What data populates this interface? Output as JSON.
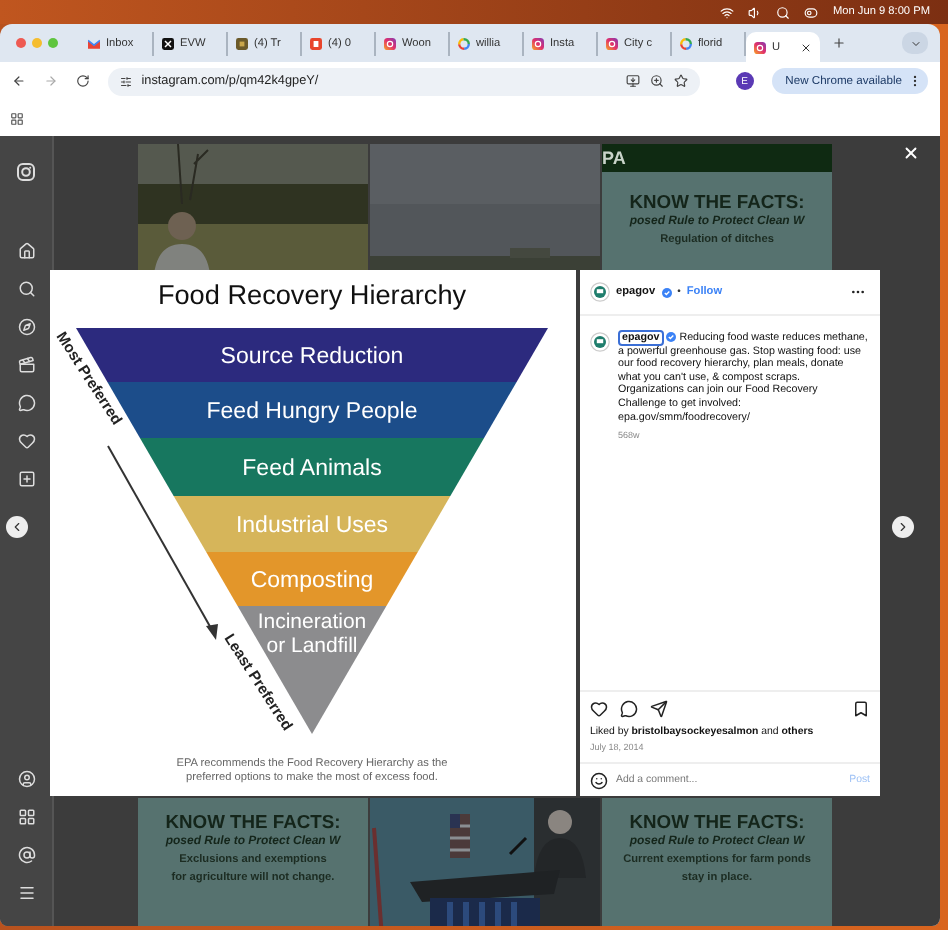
{
  "menu_bar": {
    "clock": "Mon Jun 9 8:00 PM"
  },
  "browser": {
    "tabs": [
      {
        "kind": "gmail",
        "title": "Inbox",
        "selected": false
      },
      {
        "kind": "x",
        "title": "EVW",
        "selected": false
      },
      {
        "kind": "olive",
        "title": "(4) Tr",
        "selected": false
      },
      {
        "kind": "red",
        "title": "(4) 0",
        "selected": false
      },
      {
        "kind": "instagram",
        "title": "Woon",
        "selected": false
      },
      {
        "kind": "google",
        "title": "willia",
        "selected": false
      },
      {
        "kind": "instagram",
        "title": "Insta",
        "selected": false
      },
      {
        "kind": "instagram",
        "title": "City c",
        "selected": false
      },
      {
        "kind": "google",
        "title": "florid",
        "selected": false
      },
      {
        "kind": "instagram",
        "title": "U",
        "selected": true
      }
    ],
    "address": "instagram.com/p/qm42k4gpeY/",
    "profile_initial": "E",
    "update_button": "New Chrome available"
  },
  "feed": {
    "rows": [
      {
        "tiles": [
          {
            "kind": "picture"
          },
          {
            "kind": "picture"
          },
          {
            "kind": "graphic",
            "header": "PA",
            "title": "KNOW THE FACTS:",
            "subtitle": "posed Rule to Protect Clean W",
            "body": [
              "Regulation of ditches"
            ]
          }
        ]
      },
      {
        "tiles": [
          {
            "kind": "graphic",
            "title": "KNOW THE FACTS:",
            "subtitle": "posed Rule to Protect Clean W",
            "body": [
              "Exclusions and exemptions",
              "for agriculture will not change."
            ]
          },
          {
            "kind": "picture"
          },
          {
            "kind": "graphic",
            "title": "KNOW THE FACTS:",
            "subtitle": "posed Rule to Protect Clean W",
            "body": [
              "Current exemptions for farm ponds",
              "stay in place."
            ]
          }
        ]
      }
    ]
  },
  "post": {
    "image": {
      "title": "Food Recovery Hierarchy",
      "bands": [
        {
          "lines": [
            "Source Reduction"
          ],
          "color": "#2c2a7e"
        },
        {
          "lines": [
            "Feed Hungry People"
          ],
          "color": "#1c4d8a"
        },
        {
          "lines": [
            "Feed Animals"
          ],
          "color": "#17775f"
        },
        {
          "lines": [
            "Industrial Uses"
          ],
          "color": "#d6b55a"
        },
        {
          "lines": [
            "Composting"
          ],
          "color": "#e3962a"
        },
        {
          "lines": [
            "Incineration",
            "or Landfill"
          ],
          "color": "#8c8c8e"
        }
      ],
      "top_label": "Most Preferred",
      "bottom_label": "Least Preferred",
      "caption": [
        "EPA recommends the Food Recovery Hierarchy as the",
        "preferred options to make the most of excess food."
      ]
    },
    "author": "epagov",
    "separator": "•",
    "follow": "Follow",
    "caption_author": "epagov",
    "caption": "Reducing food waste reduces methane, a powerful greenhouse gas. Stop wasting food: use our food recovery hierarchy, plan meals, donate what you can't use, & compost scraps. Organizations can join our Food Recovery Challenge to get involved: epa.gov/smm/foodrecovery/",
    "age": "568w",
    "liked_by": "Liked by **bristolbaysockeyesalmon** and **others**",
    "date": "July 18, 2014",
    "comment_placeholder": "Add a comment...",
    "post_button": "Post"
  }
}
